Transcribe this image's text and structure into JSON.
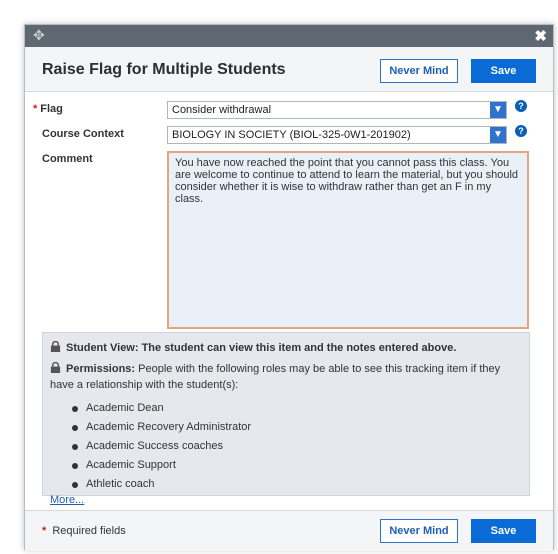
{
  "dialog": {
    "title": "Raise Flag for Multiple Students",
    "header_buttons": {
      "cancel_label": "Never Mind",
      "save_label": "Save"
    },
    "icons": {
      "drag": "drag-handle-icon",
      "close": "close-icon"
    }
  },
  "form": {
    "flag": {
      "label": "Flag",
      "value": "Consider withdrawal"
    },
    "course_context": {
      "label": "Course Context",
      "value": "BIOLOGY IN SOCIETY (BIOL-325-0W1-201902)"
    },
    "comment": {
      "label": "Comment",
      "value": "You have now reached the point that you cannot pass this class.  You are welcome to continue to attend to learn the material, but you should consider whether it is wise to withdraw rather than get an F in my class."
    },
    "required_marker": "*",
    "help_glyph": "?"
  },
  "info": {
    "student_view": "Student View: The student can view this item and the notes entered above.",
    "permissions_label": "Permissions:",
    "permissions_text": "People with the following roles may be able to see this tracking item if they have a relationship with the student(s):",
    "roles": [
      "Academic Dean",
      "Academic Recovery Administrator",
      "Academic Success coaches",
      "Academic Support",
      "Athletic coach"
    ],
    "more_link": "More..."
  },
  "footer": {
    "required_note": "Required fields",
    "cancel_label": "Never Mind",
    "save_label": "Save"
  },
  "colors": {
    "primary": "#0a6bd6",
    "titlebar": "#5f6870",
    "required": "#c81f1f",
    "comment_border": "#e6a47a"
  }
}
